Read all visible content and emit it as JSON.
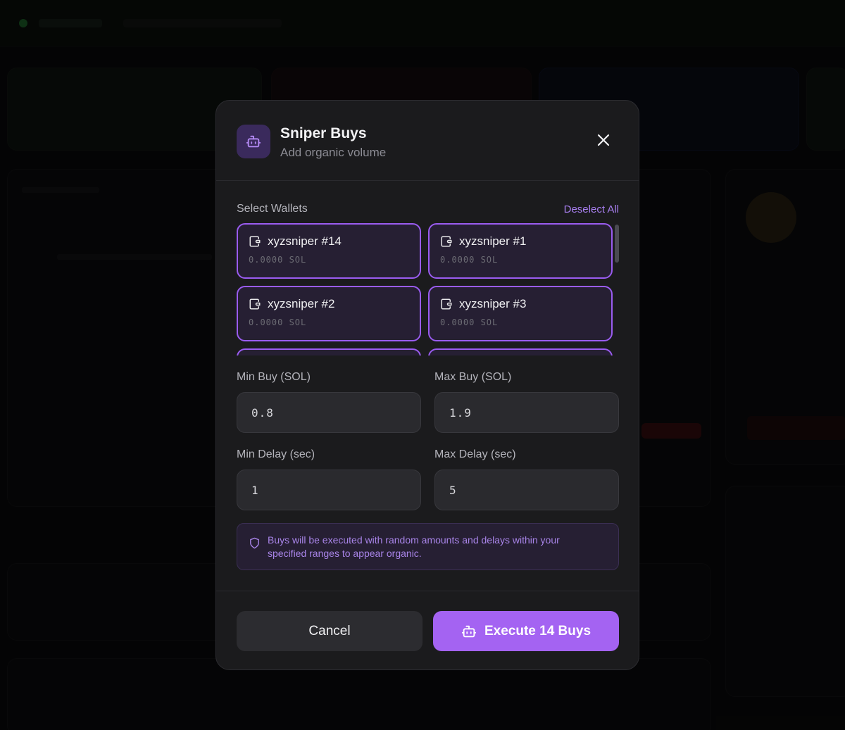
{
  "modal": {
    "title": "Sniper Buys",
    "subtitle": "Add organic volume",
    "icon": "bot-icon",
    "close_icon": "close-icon"
  },
  "wallets": {
    "label": "Select Wallets",
    "deselect_label": "Deselect All",
    "items": [
      {
        "name": "xyzsniper #14",
        "balance": "0.0000 SOL",
        "selected": true
      },
      {
        "name": "xyzsniper #1",
        "balance": "0.0000 SOL",
        "selected": true
      },
      {
        "name": "xyzsniper #2",
        "balance": "0.0000 SOL",
        "selected": true
      },
      {
        "name": "xyzsniper #3",
        "balance": "0.0000 SOL",
        "selected": true
      }
    ]
  },
  "fields": {
    "min_buy": {
      "label": "Min Buy (SOL)",
      "value": "0.8"
    },
    "max_buy": {
      "label": "Max Buy (SOL)",
      "value": "1.9"
    },
    "min_delay": {
      "label": "Min Delay (sec)",
      "value": "1"
    },
    "max_delay": {
      "label": "Max Delay (sec)",
      "value": "5"
    }
  },
  "info": {
    "text": "Buys will be executed with random amounts and delays within your specified ranges to appear organic.",
    "icon": "shield-icon"
  },
  "footer": {
    "cancel_label": "Cancel",
    "execute_label": "Execute 14 Buys"
  },
  "colors": {
    "accent": "#a463f2",
    "selected_border": "#9a5cf0",
    "info_text": "#a884e8"
  }
}
